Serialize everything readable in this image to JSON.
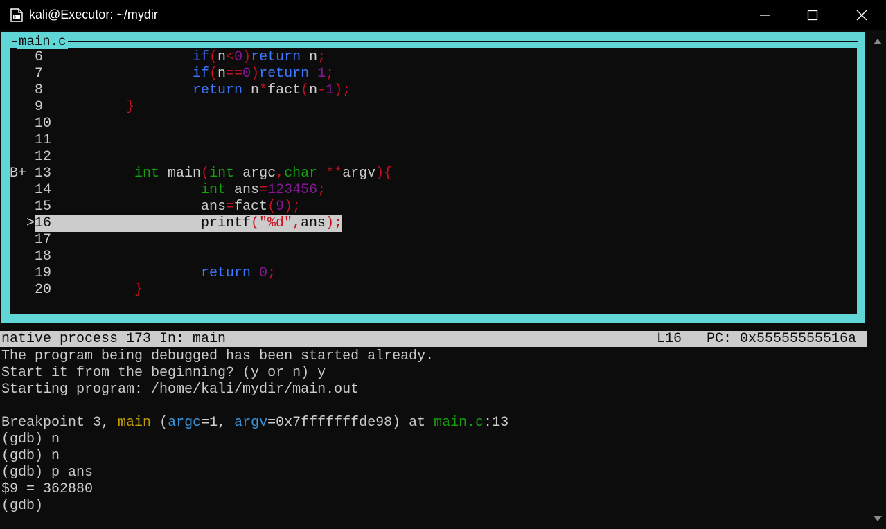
{
  "window": {
    "title": "kali@Executor: ~/mydir",
    "app_icon": "terminal-file-icon",
    "controls": [
      "minimize-icon",
      "maximize-icon",
      "close-icon"
    ]
  },
  "source": {
    "filename": "main.c",
    "breakpoint_marker": "B+",
    "current_marker": ">",
    "lines": [
      {
        "no": "6",
        "code": "if(n<0)return n;"
      },
      {
        "no": "7",
        "code": "if(n==0)return 1;"
      },
      {
        "no": "8",
        "code": "return n*fact(n-1);"
      },
      {
        "no": "9",
        "code": "}"
      },
      {
        "no": "10",
        "code": ""
      },
      {
        "no": "11",
        "code": ""
      },
      {
        "no": "12",
        "code": ""
      },
      {
        "no": "13",
        "code": "int main(int argc,char **argv){"
      },
      {
        "no": "14",
        "code": "int ans=123456;"
      },
      {
        "no": "15",
        "code": "ans=fact(9);"
      },
      {
        "no": "16",
        "code": "printf(\"%d\",ans);"
      },
      {
        "no": "17",
        "code": ""
      },
      {
        "no": "18",
        "code": ""
      },
      {
        "no": "19",
        "code": "return 0;"
      },
      {
        "no": "20",
        "code": "}"
      }
    ]
  },
  "status": {
    "process": "native process 173 In: main",
    "line": "L16",
    "pc": "PC: 0x55555555516a"
  },
  "console": {
    "lines": [
      "The program being debugged has been started already.",
      "Start it from the beginning? (y or n) y",
      "Starting program: /home/kali/mydir/main.out",
      "",
      "Breakpoint 3, main (argc=1, argv=0x7fffffffde98) at main.c:13",
      "(gdb) n",
      "(gdb) n",
      "(gdb) p ans",
      "$9 = 362880",
      "(gdb)"
    ],
    "breakpoint_parts": {
      "prefix": "Breakpoint 3, ",
      "func": "main",
      "open": " (",
      "arg1": "argc",
      "val1": "=1, ",
      "arg2": "argv",
      "val2": "=0x7fffffffde98) at ",
      "file": "main.c",
      "line": ":13"
    }
  },
  "colors": {
    "frame": "#61d6d6",
    "background": "#0c0c0c",
    "keyword": "#3b78ff",
    "type": "#13a10e",
    "punct": "#c50f1f",
    "number": "#881798",
    "function_name": "#c19c00",
    "arg_name": "#3a96dd",
    "highlight": "#cccccc"
  }
}
